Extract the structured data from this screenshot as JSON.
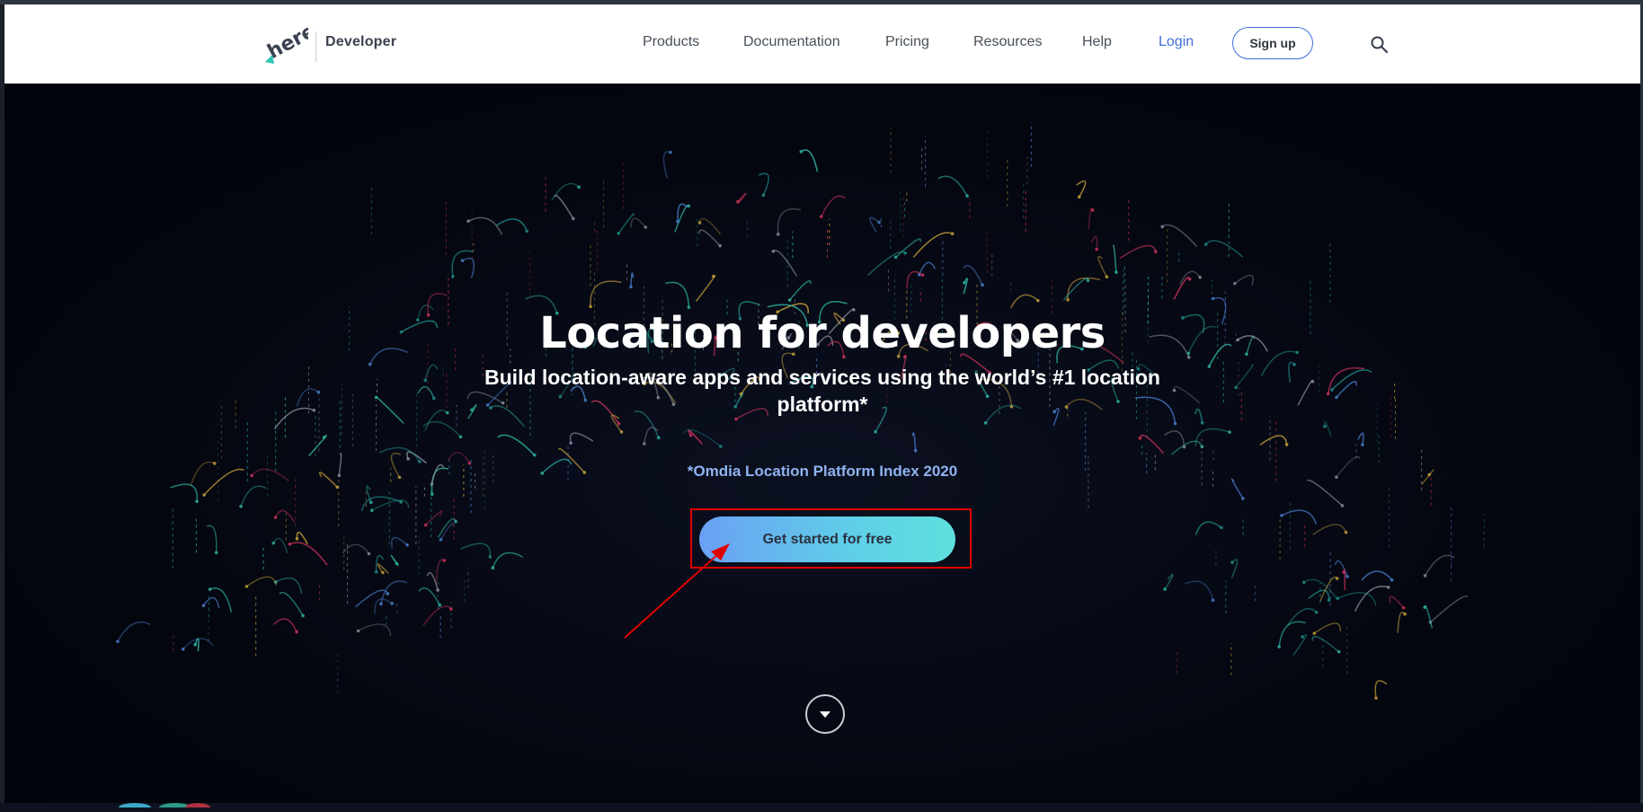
{
  "header": {
    "brand": "Developer",
    "nav": [
      {
        "label": "Products"
      },
      {
        "label": "Documentation"
      },
      {
        "label": "Pricing"
      },
      {
        "label": "Resources"
      },
      {
        "label": "Help"
      },
      {
        "label": "Login"
      }
    ],
    "signup_label": "Sign up",
    "icons": {
      "logo": "here-logo",
      "search": "search-icon"
    }
  },
  "hero": {
    "title": "Location for developers",
    "subtitle": "Build location-aware apps and services using the world’s #1 location platform*",
    "source": "*Omdia Location Platform Index 2020",
    "cta_label": "Get started for free"
  },
  "colors": {
    "accent": "#3f6fd8",
    "cta_gradient_start": "#6aa0f4",
    "cta_gradient_end": "#5ee0dd",
    "annotation": "#e00000",
    "hero_bg": "#04060f"
  }
}
